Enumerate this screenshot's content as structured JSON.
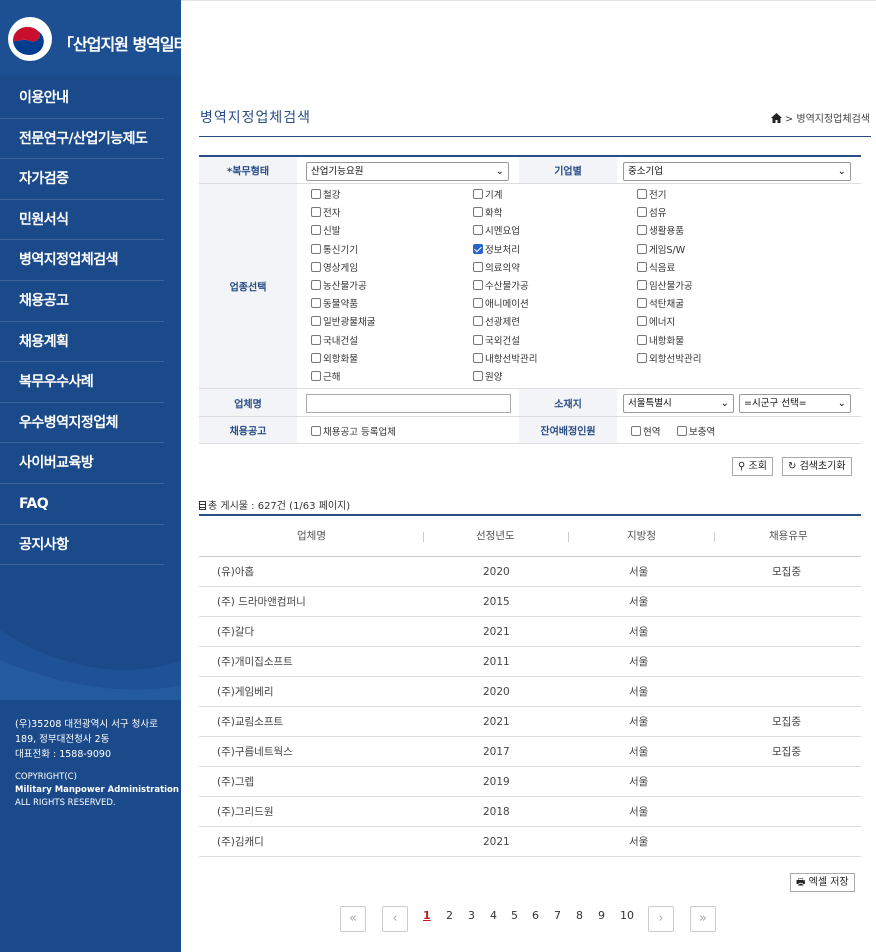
{
  "sidebar": {
    "logo_text": "「산업지원 병역일터」",
    "nav": [
      "이용안내",
      "전문연구/산업기능제도",
      "자가검증",
      "민원서식",
      "병역지정업체검색",
      "채용공고",
      "채용계획",
      "복무우수사례",
      "우수병역지정업체",
      "사이버교육방",
      "FAQ",
      "공지사항"
    ],
    "address_lines": [
      "(우)35208 대전광역시 서구 청사로",
      "189, 정부대전청사 2동",
      "대표전화 : 1588-9090"
    ],
    "copyright_lines": [
      "COPYRIGHT(C)",
      "Military Manpower Administration",
      "ALL RIGHTS RESERVED."
    ]
  },
  "header": {
    "title": "병역지정업체검색",
    "breadcrumb": "> 병역지정업체검색"
  },
  "form": {
    "service_type_label": "*복무형태",
    "service_type_value": "산업기능요원",
    "company_type_label": "기업별",
    "company_type_value": "중소기업",
    "industry_label": "업종선택",
    "industries": [
      [
        "철강",
        "기계",
        "전기"
      ],
      [
        "전자",
        "화학",
        "섬유"
      ],
      [
        "신발",
        "시멘요업",
        "생활용품"
      ],
      [
        "통신기기",
        "정보처리",
        "게임S/W"
      ],
      [
        "영상게임",
        "의료의약",
        "식음료"
      ],
      [
        "농산물가공",
        "수산물가공",
        "임산물가공"
      ],
      [
        "동물약품",
        "애니메이션",
        "석탄채굴"
      ],
      [
        "일반광물채굴",
        "선광제련",
        "에너지"
      ],
      [
        "국내건설",
        "국외건설",
        "내항화물"
      ],
      [
        "외항화물",
        "내항선박관리",
        "외항선박관리"
      ],
      [
        "근해",
        "원양",
        ""
      ]
    ],
    "checked_industry": "정보처리",
    "company_name_label": "업체명",
    "company_name_value": "",
    "location_label": "소재지",
    "location_value": "서울특별시",
    "district_value": "=시군구 선택=",
    "recruit_label": "채용공고",
    "recruit_option": "채용공고 등록업체",
    "remain_label": "잔여배정인원",
    "remain_options": [
      "현역",
      "보충역"
    ]
  },
  "actions": {
    "search": "조회",
    "reset": "검색초기화"
  },
  "results": {
    "total_text": "총 게시물 : 627건 (1/63 페이지)",
    "columns": [
      "업체명",
      "선정년도",
      "지방청",
      "채용유무"
    ],
    "rows": [
      [
        "(유)아홉",
        "2020",
        "서울",
        "모집중"
      ],
      [
        "(주) 드라마앤컴퍼니",
        "2015",
        "서울",
        ""
      ],
      [
        "(주)갈다",
        "2021",
        "서울",
        ""
      ],
      [
        "(주)개미집소프트",
        "2011",
        "서울",
        ""
      ],
      [
        "(주)게임베리",
        "2020",
        "서울",
        ""
      ],
      [
        "(주)교림소프트",
        "2021",
        "서울",
        "모집중"
      ],
      [
        "(주)구름네트웍스",
        "2017",
        "서울",
        "모집중"
      ],
      [
        "(주)그렙",
        "2019",
        "서울",
        ""
      ],
      [
        "(주)그리드원",
        "2018",
        "서울",
        ""
      ],
      [
        "(주)김캐디",
        "2021",
        "서울",
        ""
      ]
    ],
    "excel_label": "엑셀 저장"
  },
  "pagination": {
    "first": "«",
    "prev": "‹",
    "pages": [
      "1",
      "2",
      "3",
      "4",
      "5",
      "6",
      "7",
      "8",
      "9",
      "10"
    ],
    "current": "1",
    "next": "›",
    "last": "»"
  },
  "colors": {
    "sidebar": "#1b4a8a",
    "accent": "#2a4d86",
    "current_page": "#c41b1b"
  }
}
